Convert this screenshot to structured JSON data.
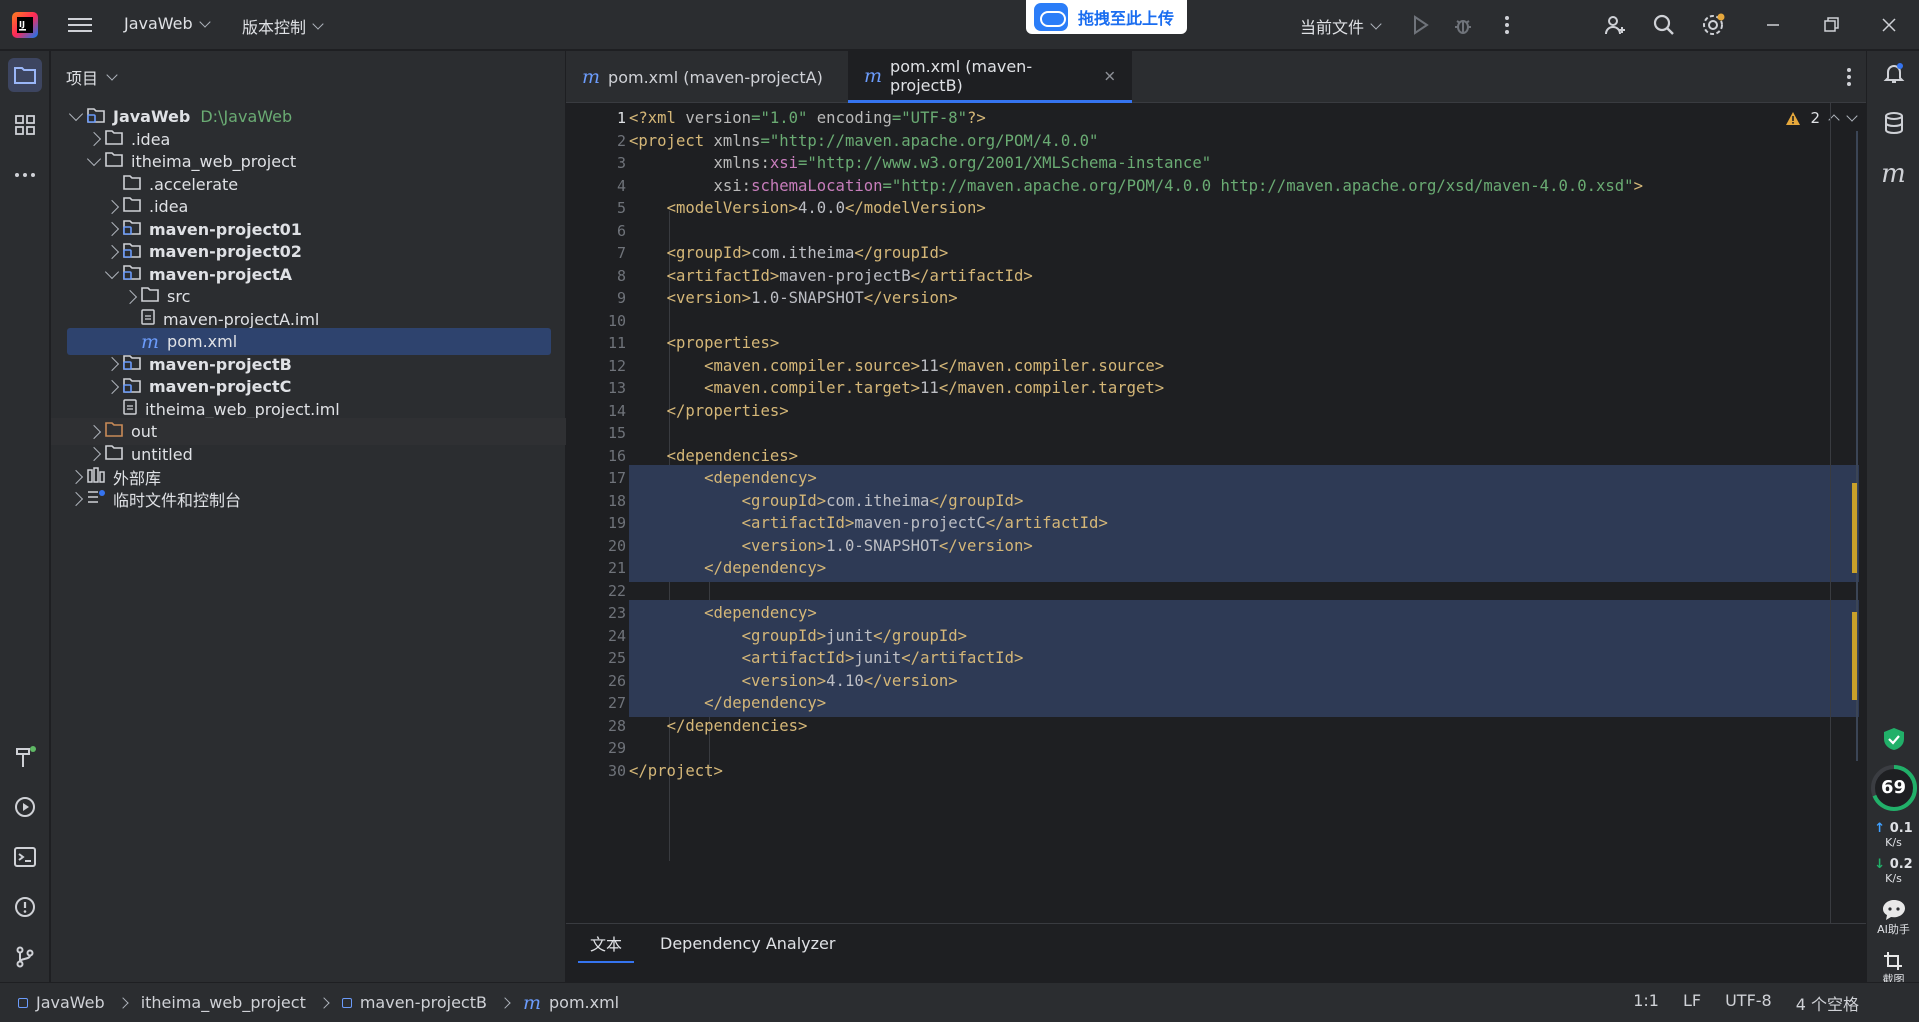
{
  "titlebar": {
    "project_name": "JavaWeb",
    "vcs_label": "版本控制",
    "upload_label": "拖拽至此上传",
    "run_config": "当前文件"
  },
  "project_panel": {
    "title": "项目",
    "tree": [
      {
        "label": "JavaWeb",
        "hint": "D:\\JavaWeb",
        "icon": "module-folder",
        "arrow": "down",
        "bold": true
      },
      {
        "label": ".idea",
        "icon": "folder",
        "arrow": "right"
      },
      {
        "label": "itheima_web_project",
        "icon": "folder",
        "arrow": "down"
      },
      {
        "label": ".accelerate",
        "icon": "folder",
        "arrow": "none"
      },
      {
        "label": ".idea",
        "icon": "folder",
        "arrow": "right"
      },
      {
        "label": "maven-project01",
        "icon": "module-folder",
        "arrow": "right",
        "bold": true
      },
      {
        "label": "maven-project02",
        "icon": "module-folder",
        "arrow": "right",
        "bold": true
      },
      {
        "label": "maven-projectA",
        "icon": "module-folder",
        "arrow": "down",
        "bold": true
      },
      {
        "label": "src",
        "icon": "folder",
        "arrow": "right"
      },
      {
        "label": "maven-projectA.iml",
        "icon": "iml-file",
        "arrow": "none"
      },
      {
        "label": "pom.xml",
        "icon": "maven-file",
        "arrow": "none",
        "selected": true
      },
      {
        "label": "maven-projectB",
        "icon": "module-folder",
        "arrow": "right",
        "bold": true
      },
      {
        "label": "maven-projectC",
        "icon": "module-folder",
        "arrow": "right",
        "bold": true
      },
      {
        "label": "itheima_web_project.iml",
        "icon": "iml-file",
        "arrow": "none"
      },
      {
        "label": "out",
        "icon": "excluded-folder",
        "arrow": "right"
      },
      {
        "label": "untitled",
        "icon": "folder",
        "arrow": "right"
      },
      {
        "label": "外部库",
        "icon": "library",
        "arrow": "right"
      },
      {
        "label": "临时文件和控制台",
        "icon": "scratches",
        "arrow": "right"
      }
    ]
  },
  "editor": {
    "tabs": [
      {
        "label": "pom.xml (maven-projectA)",
        "active": false
      },
      {
        "label": "pom.xml (maven-projectB)",
        "active": true
      }
    ],
    "inspection_count": "2",
    "bottom_tabs": [
      "文本",
      "Dependency Analyzer"
    ],
    "code_lines": [
      "<?xml version=\"1.0\" encoding=\"UTF-8\"?>",
      "<project xmlns=\"http://maven.apache.org/POM/4.0.0\"",
      "         xmlns:xsi=\"http://www.w3.org/2001/XMLSchema-instance\"",
      "         xsi:schemaLocation=\"http://maven.apache.org/POM/4.0.0 http://maven.apache.org/xsd/maven-4.0.0.xsd\">",
      "    <modelVersion>4.0.0</modelVersion>",
      "",
      "    <groupId>com.itheima</groupId>",
      "    <artifactId>maven-projectB</artifactId>",
      "    <version>1.0-SNAPSHOT</version>",
      "",
      "    <properties>",
      "        <maven.compiler.source>11</maven.compiler.source>",
      "        <maven.compiler.target>11</maven.compiler.target>",
      "    </properties>",
      "",
      "    <dependencies>",
      "        <dependency>",
      "            <groupId>com.itheima</groupId>",
      "            <artifactId>maven-projectC</artifactId>",
      "            <version>1.0-SNAPSHOT</version>",
      "        </dependency>",
      "",
      "        <dependency>",
      "            <groupId>junit</groupId>",
      "            <artifactId>junit</artifactId>",
      "            <version>4.10</version>",
      "        </dependency>",
      "    </dependencies>",
      "",
      "</project>"
    ],
    "highlighted_lines": [
      17,
      18,
      19,
      20,
      21,
      23,
      24,
      25,
      26,
      27
    ]
  },
  "rightstrip": {
    "performance_percent": "69",
    "upload_speed": "0.1",
    "download_speed": "0.2",
    "speed_unit": "K/s",
    "ai_label": "AI助手",
    "screenshot_label": "截图"
  },
  "statusbar": {
    "breadcrumb": [
      "JavaWeb",
      "itheima_web_project",
      "maven-projectB",
      "pom.xml"
    ],
    "position": "1:1",
    "line_sep": "LF",
    "encoding": "UTF-8",
    "indent": "4 个空格"
  },
  "colors": {
    "accent": "#3574f0",
    "xml_tag": "#d5b778",
    "xml_string": "#6aab73",
    "selection": "#2e436e"
  }
}
